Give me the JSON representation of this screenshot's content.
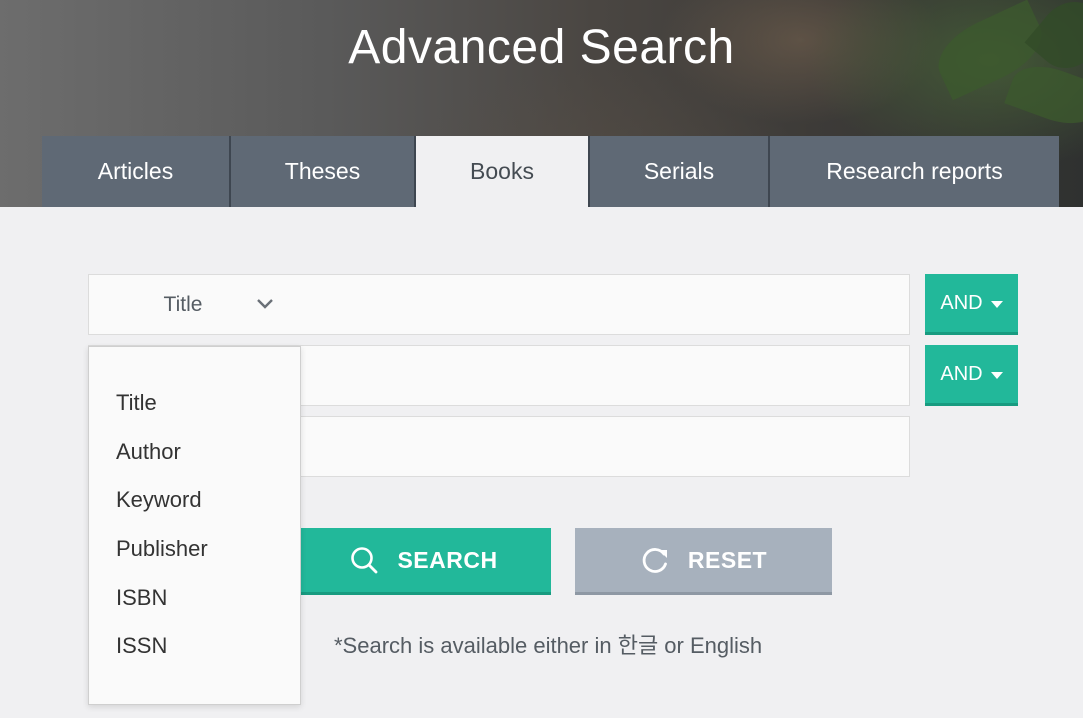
{
  "header": {
    "title": "Advanced Search"
  },
  "tabs": [
    {
      "label": "Articles",
      "active": false
    },
    {
      "label": "Theses",
      "active": false
    },
    {
      "label": "Books",
      "active": true
    },
    {
      "label": "Serials",
      "active": false
    },
    {
      "label": "Research reports",
      "active": false
    }
  ],
  "search_rows": [
    {
      "field": "Title",
      "value": "",
      "operator": "AND"
    },
    {
      "field": "",
      "value": "",
      "operator": "AND"
    },
    {
      "field": "",
      "value": ""
    }
  ],
  "dropdown": {
    "open": true,
    "options": [
      "Title",
      "Author",
      "Keyword",
      "Publisher",
      "ISBN",
      "ISSN"
    ]
  },
  "actions": {
    "search_label": "SEARCH",
    "reset_label": "RESET"
  },
  "notice": "*Search is available either in 한글 or English",
  "colors": {
    "accent": "#22b89a",
    "tab_bg": "#5f6975",
    "reset_bg": "#a7b1bd",
    "page_bg": "#f0f0f2"
  },
  "icons": {
    "search": "search-icon",
    "reset": "refresh-icon",
    "select": "chevron-down-icon",
    "operator": "caret-down-icon"
  }
}
